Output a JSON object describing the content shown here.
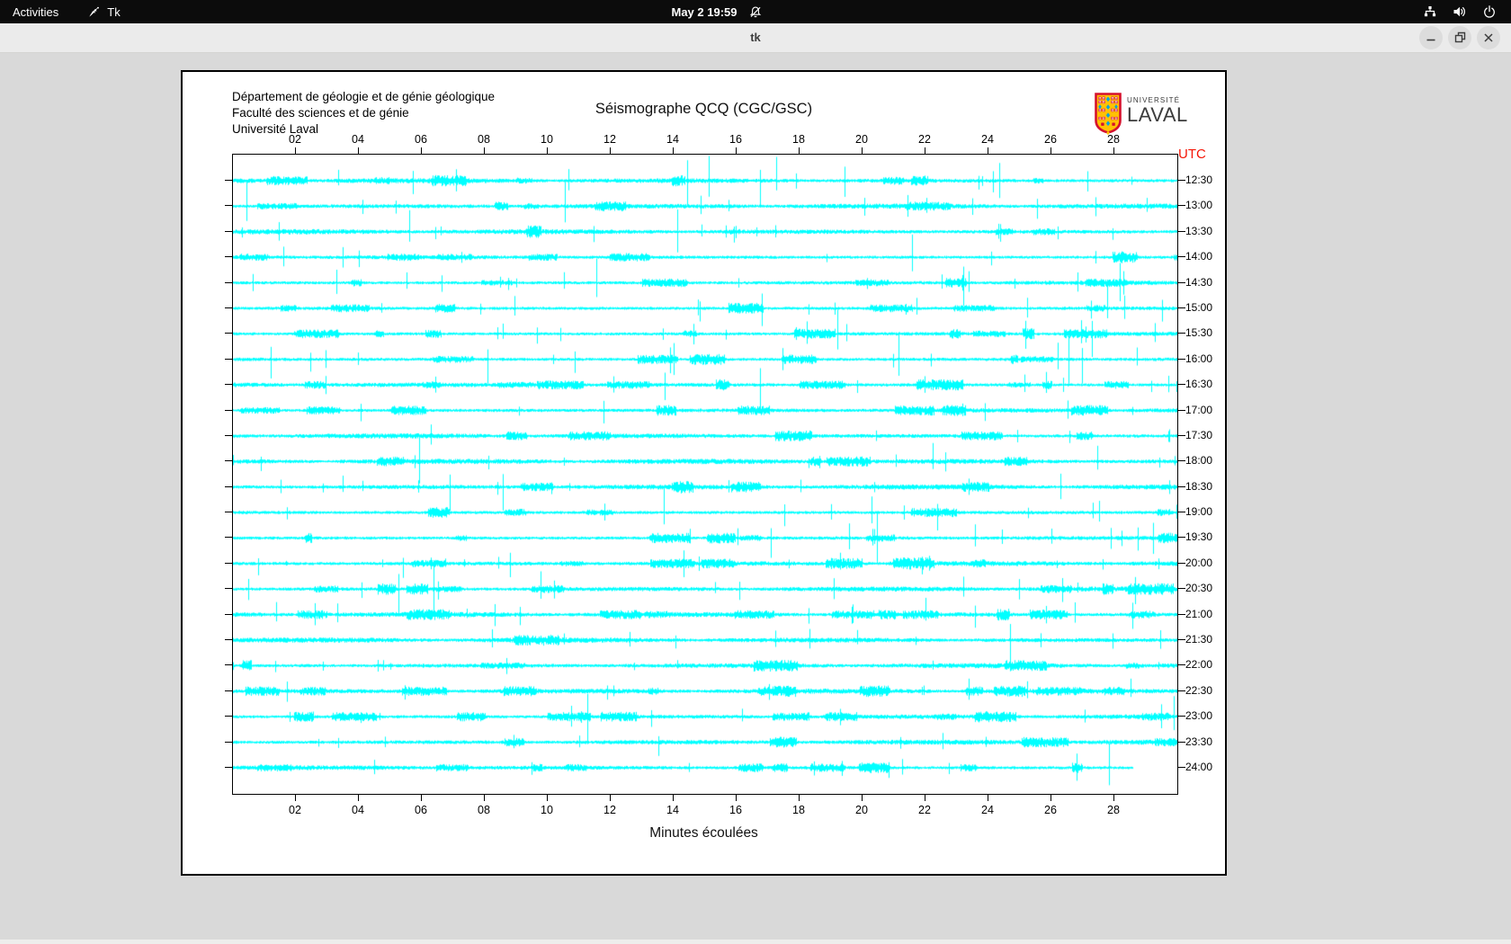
{
  "top_bar": {
    "activities_label": "Activities",
    "app_name": "Tk",
    "clock": "May 2 19:59",
    "status_icons": [
      "notifications-muted",
      "network-wired",
      "volume",
      "power"
    ]
  },
  "window": {
    "title": "tk",
    "controls": [
      "minimize",
      "maximize",
      "close"
    ]
  },
  "seismograph": {
    "header_lines": [
      "Département de géologie et de génie géologique",
      "Faculté des sciences et de génie",
      "Université Laval"
    ],
    "title": "Séismographe QCQ (CGC/GSC)",
    "logo": {
      "line1": "UNIVERSITÉ",
      "line2": "LAVAL"
    },
    "utc_label": "UTC",
    "xlabel": "Minutes écoulées"
  },
  "chart_data": {
    "type": "line",
    "variant": "helicorder-seismogram",
    "title": "Séismographe QCQ (CGC/GSC)",
    "xlabel": "Minutes écoulées",
    "right_axis_label": "UTC",
    "grid": false,
    "legend": "none",
    "x_range_minutes": [
      0,
      30
    ],
    "minutes_per_row": 30,
    "x_tick_labels": [
      "02",
      "04",
      "06",
      "08",
      "10",
      "12",
      "14",
      "16",
      "18",
      "20",
      "22",
      "24",
      "26",
      "28"
    ],
    "rows": 24,
    "row_utc_times": [
      "12:30",
      "13:00",
      "13:30",
      "14:00",
      "14:30",
      "15:00",
      "15:30",
      "16:00",
      "16:30",
      "17:00",
      "17:30",
      "18:00",
      "18:30",
      "19:00",
      "19:30",
      "20:00",
      "20:30",
      "21:00",
      "21:30",
      "22:00",
      "22:30",
      "23:00",
      "23:30",
      "24:00"
    ],
    "last_row_fraction": 0.953,
    "trace_color": "#00ffff",
    "axis_color": "#000000",
    "utc_label_color": "#f51505",
    "seed": 20240502
  }
}
